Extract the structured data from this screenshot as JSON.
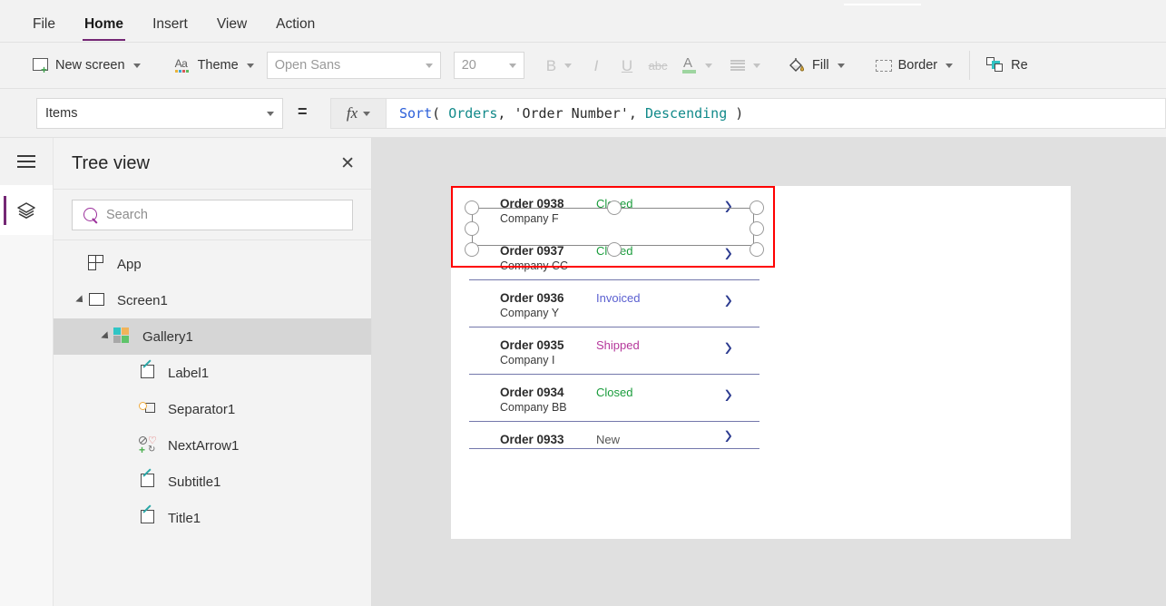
{
  "menu": {
    "items": [
      {
        "label": "File",
        "active": false
      },
      {
        "label": "Home",
        "active": true
      },
      {
        "label": "Insert",
        "active": false
      },
      {
        "label": "View",
        "active": false
      },
      {
        "label": "Action",
        "active": false
      }
    ]
  },
  "ribbon": {
    "new_screen": "New screen",
    "theme": "Theme",
    "font_family": "Open Sans",
    "font_size": "20",
    "bold": "B",
    "italic": "I",
    "underline": "U",
    "strikethrough": "abc",
    "font_color": "A",
    "fill": "Fill",
    "border": "Border",
    "reorder": "Re"
  },
  "formula_bar": {
    "property": "Items",
    "equals": "=",
    "fx": "fx",
    "tokens": [
      {
        "text": "Sort",
        "color": "#2b5fd9"
      },
      {
        "text": "( ",
        "color": "#2b2b2b"
      },
      {
        "text": "Orders",
        "color": "#128a8a"
      },
      {
        "text": ", ",
        "color": "#2b2b2b"
      },
      {
        "text": "'Order Number'",
        "color": "#2b2b2b"
      },
      {
        "text": ", ",
        "color": "#2b2b2b"
      },
      {
        "text": "Descending",
        "color": "#128a8a"
      },
      {
        "text": " )",
        "color": "#2b2b2b"
      }
    ]
  },
  "tree_panel": {
    "title": "Tree view",
    "close": "✕",
    "search_placeholder": "Search",
    "nodes": [
      {
        "label": "App",
        "indent": 0,
        "icon": "app-icon",
        "expandable": false,
        "selected": false
      },
      {
        "label": "Screen1",
        "indent": 0,
        "icon": "screen-icon",
        "expandable": true,
        "selected": false
      },
      {
        "label": "Gallery1",
        "indent": 1,
        "icon": "gallery-icon",
        "expandable": true,
        "selected": true
      },
      {
        "label": "Label1",
        "indent": 2,
        "icon": "label-icon",
        "expandable": false,
        "selected": false
      },
      {
        "label": "Separator1",
        "indent": 2,
        "icon": "separator-icon",
        "expandable": false,
        "selected": false
      },
      {
        "label": "NextArrow1",
        "indent": 2,
        "icon": "nextarrow-icon",
        "expandable": false,
        "selected": false
      },
      {
        "label": "Subtitle1",
        "indent": 2,
        "icon": "label-icon",
        "expandable": false,
        "selected": false
      },
      {
        "label": "Title1",
        "indent": 2,
        "icon": "label-icon",
        "expandable": false,
        "selected": false
      }
    ]
  },
  "canvas": {
    "gallery": {
      "rows": [
        {
          "title": "Order 0938",
          "subtitle": "Company F",
          "status": "Closed",
          "status_color": "#1a9c3c",
          "selected": true,
          "clipped": false
        },
        {
          "title": "Order 0937",
          "subtitle": "Company CC",
          "status": "Closed",
          "status_color": "#1a9c3c",
          "selected": false,
          "clipped": false
        },
        {
          "title": "Order 0936",
          "subtitle": "Company Y",
          "status": "Invoiced",
          "status_color": "#5a5fd0",
          "selected": false,
          "clipped": false
        },
        {
          "title": "Order 0935",
          "subtitle": "Company I",
          "status": "Shipped",
          "status_color": "#b5379b",
          "selected": false,
          "clipped": false
        },
        {
          "title": "Order 0934",
          "subtitle": "Company BB",
          "status": "Closed",
          "status_color": "#1a9c3c",
          "selected": false,
          "clipped": false
        },
        {
          "title": "Order 0933",
          "subtitle": "",
          "status": "New",
          "status_color": "#555555",
          "selected": false,
          "clipped": true
        }
      ],
      "arrow": "›",
      "selection_color": "#ff0000"
    }
  }
}
